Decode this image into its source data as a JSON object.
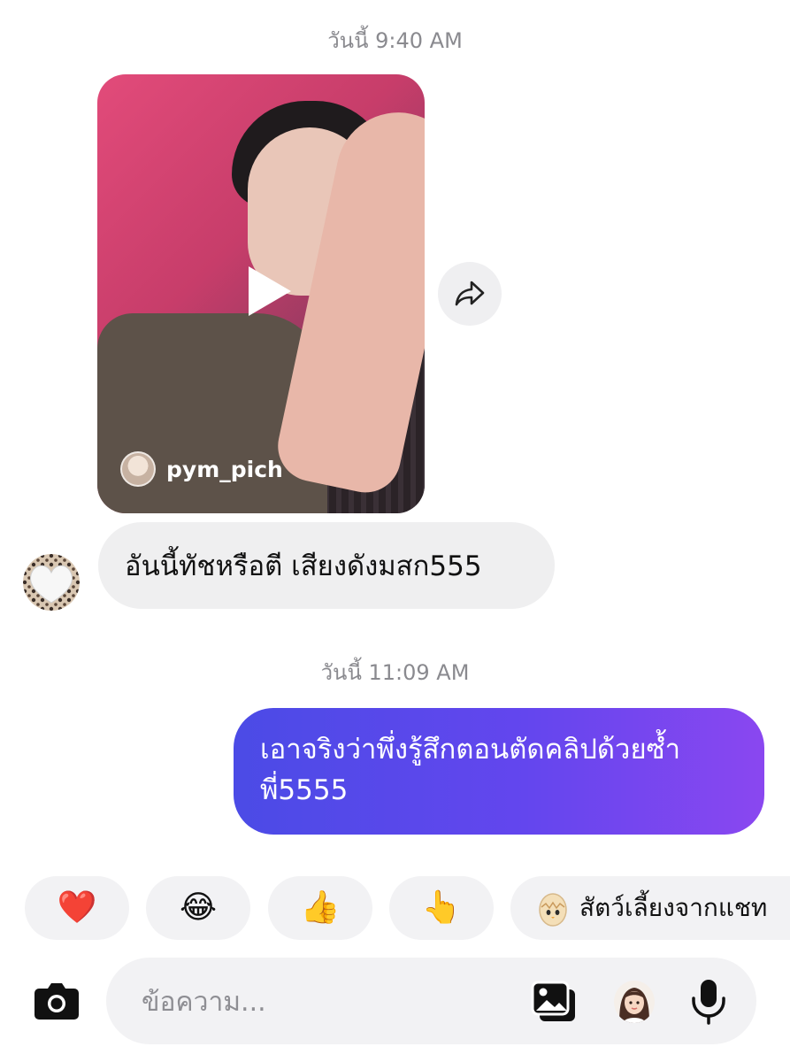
{
  "thread": {
    "timestamp_1": "วันนี้ 9:40 AM",
    "timestamp_2": "วันนี้ 11:09 AM"
  },
  "shared_reel": {
    "username": "pym_pich",
    "play_icon": "play-icon",
    "share_icon": "share-arrow-icon"
  },
  "incoming_message": {
    "text": "อันนี้ทัชหรือตี เสียงดังมสก555",
    "avatar_icon": "white-heart-icon"
  },
  "outgoing_message": {
    "text": "เอาจริงว่าพึ่งรู้สึกตอนตัดคลิปด้วยซ้ำพี่5555"
  },
  "quick_reactions": [
    {
      "emoji": "❤️",
      "name": "heart"
    },
    {
      "emoji": "😂",
      "name": "laugh"
    },
    {
      "emoji": "👍",
      "name": "thumbs-up"
    },
    {
      "emoji": "👆",
      "name": "point"
    }
  ],
  "chat_pet_chip": {
    "label": "สัตว์เลี้ยงจากแชท",
    "icon": "egg-icon"
  },
  "composer": {
    "placeholder": "ข้อความ...",
    "camera_icon": "camera-icon",
    "gallery_icon": "gallery-icon",
    "sticker_icon": "avatar-sticker-icon",
    "mic_icon": "microphone-icon"
  },
  "colors": {
    "outgoing_gradient_start": "#4b4be6",
    "outgoing_gradient_end": "#8a47f0",
    "bubble_gray": "#efeff0"
  }
}
